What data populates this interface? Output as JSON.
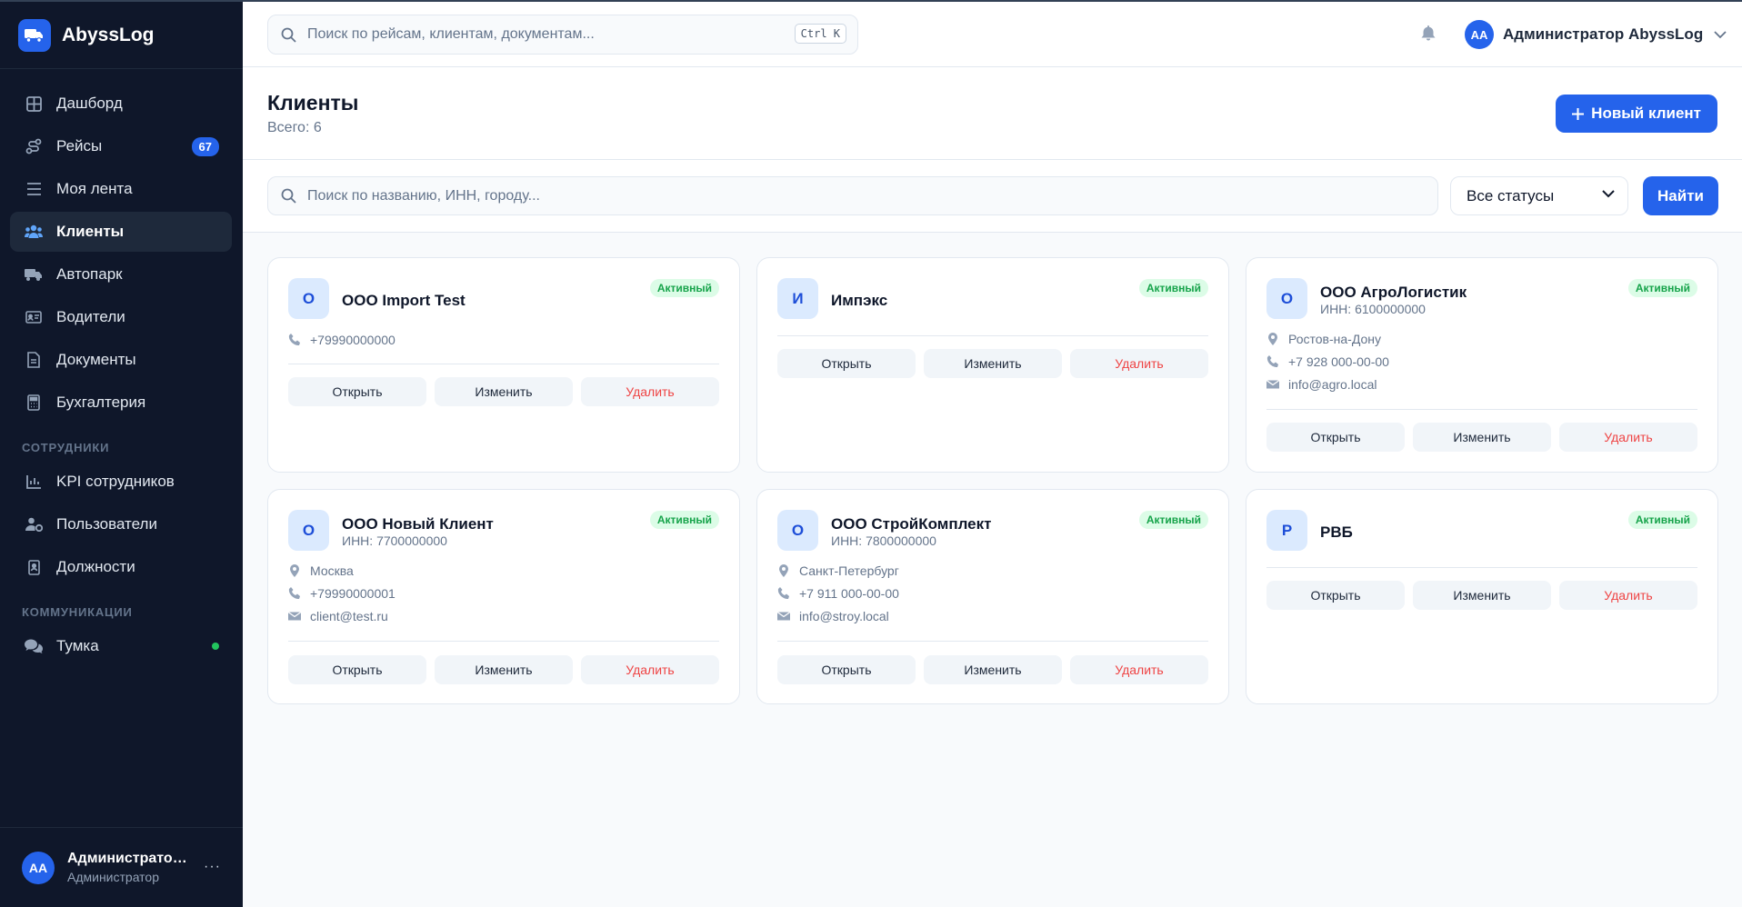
{
  "brand": {
    "name": "AbyssLog"
  },
  "sidebar": {
    "items": [
      {
        "label": "Дашборд"
      },
      {
        "label": "Рейсы",
        "badge": "67"
      },
      {
        "label": "Моя лента"
      },
      {
        "label": "Клиенты",
        "active": true
      },
      {
        "label": "Автопарк"
      },
      {
        "label": "Водители"
      },
      {
        "label": "Документы"
      },
      {
        "label": "Бухгалтерия"
      }
    ],
    "section_staff": "СОТРУДНИКИ",
    "staff_items": [
      {
        "label": "KPI сотрудников"
      },
      {
        "label": "Пользователи"
      },
      {
        "label": "Должности"
      }
    ],
    "section_comms": "КОММУНИКАЦИИ",
    "comms_items": [
      {
        "label": "Тумка"
      }
    ],
    "user": {
      "initials": "AA",
      "name": "Администратор AbyssLog",
      "role": "Администратор",
      "more": "···"
    }
  },
  "topbar": {
    "search_placeholder": "Поиск по рейсам, клиентам, документам...",
    "shortcut": "Ctrl K",
    "user_initials": "AA",
    "user_name": "Администратор AbyssLog"
  },
  "page": {
    "title": "Клиенты",
    "subtitle": "Всего: 6",
    "new_button": "Новый клиент"
  },
  "filters": {
    "search_placeholder": "Поиск по названию, ИНН, городу...",
    "status_value": "Все статусы",
    "find_button": "Найти"
  },
  "colors": {
    "accent": "#2563eb",
    "sidebar_bg": "#0f172a",
    "active_badge_bg": "#dcfce7",
    "active_badge_text": "#16a34a",
    "danger": "#ef4444"
  },
  "cards": [
    {
      "initial": "О",
      "name": "ООО Import Test",
      "status": "Активный",
      "phone": "+79990000000",
      "open": "Открыть",
      "edit": "Изменить",
      "delete": "Удалить"
    },
    {
      "initial": "И",
      "name": "Импэкс",
      "status": "Активный",
      "open": "Открыть",
      "edit": "Изменить",
      "delete": "Удалить"
    },
    {
      "initial": "О",
      "name": "ООО АгроЛогистик",
      "inn": "ИНН: 6100000000",
      "status": "Активный",
      "city": "Ростов-на-Дону",
      "phone": "+7 928 000-00-00",
      "email": "info@agro.local",
      "open": "Открыть",
      "edit": "Изменить",
      "delete": "Удалить"
    },
    {
      "initial": "О",
      "name": "ООО Новый Клиент",
      "inn": "ИНН: 7700000000",
      "status": "Активный",
      "city": "Москва",
      "phone": "+79990000001",
      "email": "client@test.ru",
      "open": "Открыть",
      "edit": "Изменить",
      "delete": "Удалить"
    },
    {
      "initial": "О",
      "name": "ООО СтройКомплект",
      "inn": "ИНН: 7800000000",
      "status": "Активный",
      "city": "Санкт-Петербург",
      "phone": "+7 911 000-00-00",
      "email": "info@stroy.local",
      "open": "Открыть",
      "edit": "Изменить",
      "delete": "Удалить"
    },
    {
      "initial": "Р",
      "name": "РВБ",
      "status": "Активный",
      "open": "Открыть",
      "edit": "Изменить",
      "delete": "Удалить"
    }
  ]
}
